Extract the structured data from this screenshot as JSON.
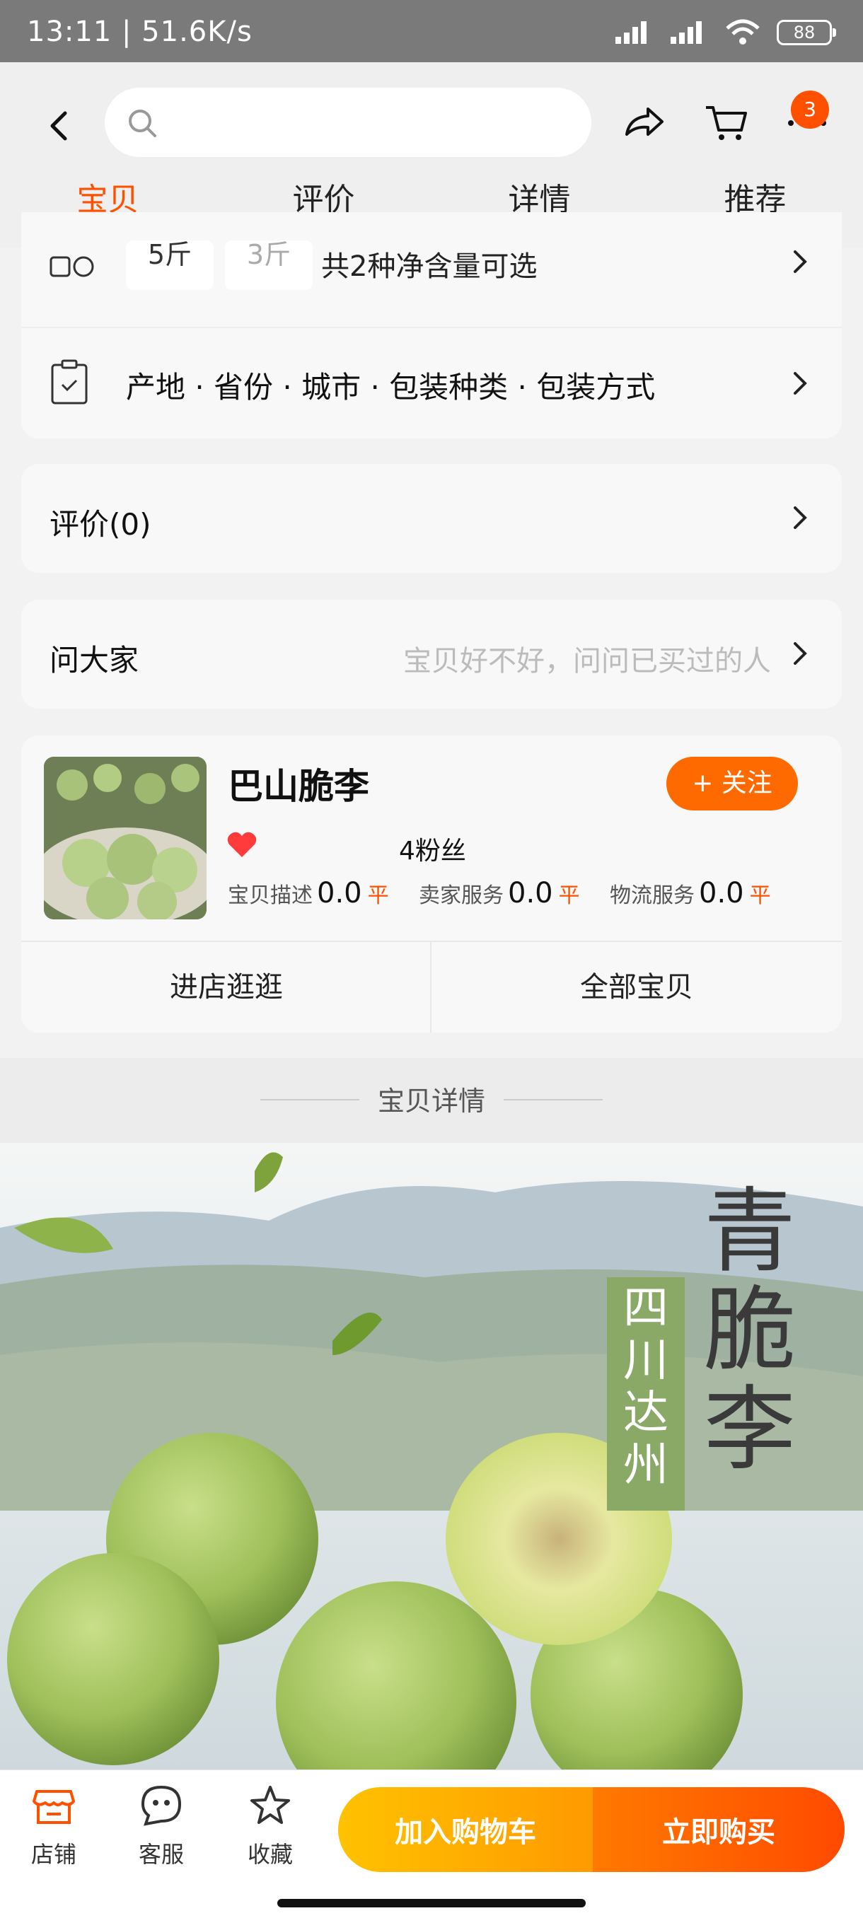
{
  "status_bar": {
    "time": "13:11 | 51.6K/s",
    "battery": "88"
  },
  "header": {
    "search_placeholder": "",
    "cart_badge": "3",
    "tabs": [
      {
        "label": "宝贝",
        "active": true
      },
      {
        "label": "评价",
        "active": false
      },
      {
        "label": "详情",
        "active": false
      },
      {
        "label": "推荐",
        "active": false
      }
    ]
  },
  "spec": {
    "chips": [
      "5斤",
      "3斤"
    ],
    "summary": "共2种净含量可选",
    "params": "产地 · 省份 · 城市 · 包装种类 · 包装方式"
  },
  "reviews": {
    "label": "评价(0)"
  },
  "ask": {
    "label": "问大家",
    "hint": "宝贝好不好，问问已买过的人"
  },
  "shop": {
    "name": "巴山脆李",
    "fans": "4粉丝",
    "follow_label": "+ 关注",
    "metrics": [
      {
        "label": "宝贝描述",
        "value": "0.0",
        "level": "平"
      },
      {
        "label": "卖家服务",
        "value": "0.0",
        "level": "平"
      },
      {
        "label": "物流服务",
        "value": "0.0",
        "level": "平"
      }
    ],
    "enter_label": "进店逛逛",
    "all_label": "全部宝贝"
  },
  "detail": {
    "section_title": "宝贝详情",
    "banner_title": "青脆李",
    "banner_origin": "四川达州"
  },
  "bottom_bar": {
    "shop": "店铺",
    "service": "客服",
    "favorite": "收藏",
    "add_cart": "加入购物车",
    "buy_now": "立即购买"
  },
  "colors": {
    "accent": "#ff5000",
    "cart_btn": "#ffb000",
    "buy_btn": "#ff5a00"
  }
}
